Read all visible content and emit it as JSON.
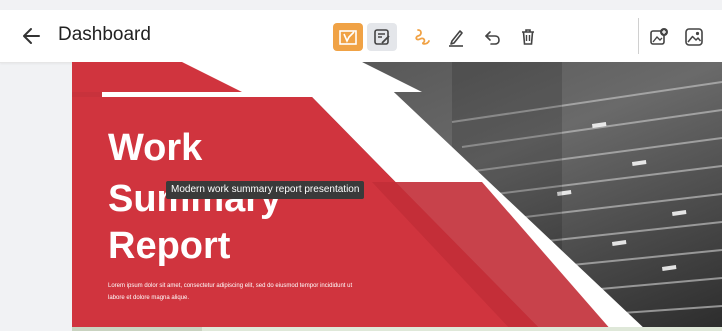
{
  "header": {
    "title": "Dashboard",
    "back_icon": "arrow-left-icon"
  },
  "toolbar": {
    "active_color": "#f0a245",
    "selected_bg": "#e4e6ea",
    "tools": [
      {
        "name": "slide-edit",
        "icon": "frame-pen-icon"
      },
      {
        "name": "notes",
        "icon": "note-edit-icon"
      },
      {
        "name": "gesture",
        "icon": "gesture-icon"
      },
      {
        "name": "pen",
        "icon": "pen-icon"
      },
      {
        "name": "undo",
        "icon": "undo-icon"
      },
      {
        "name": "delete",
        "icon": "trash-icon"
      },
      {
        "name": "add-image",
        "icon": "image-plus-icon"
      },
      {
        "name": "image",
        "icon": "image-icon"
      }
    ]
  },
  "slide": {
    "title_line1": "Work",
    "title_line2": "Summary",
    "title_line3": "Report",
    "body_text": "Lorem ipsum dolor sit amet, consectetur adipiscing elit, sed do eiusmod tempor incididunt ut labore et dolore magna alique.",
    "accent_color": "#d0343e"
  },
  "tooltip": {
    "text": "Modern work summary report presentation"
  }
}
